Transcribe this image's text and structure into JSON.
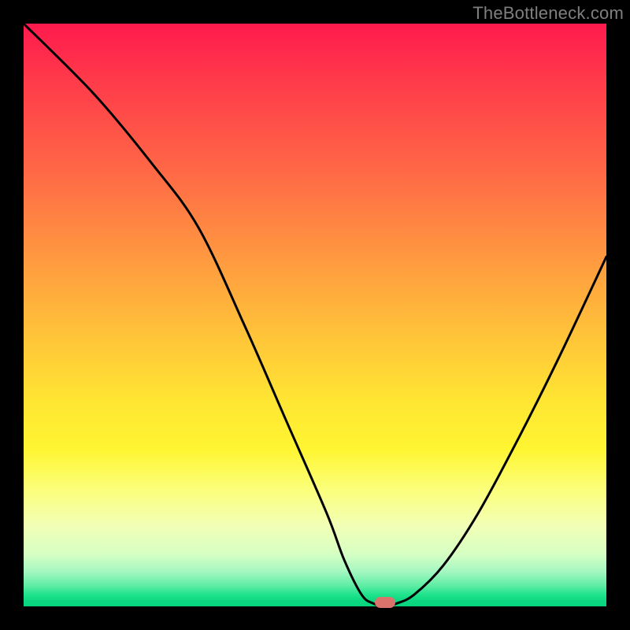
{
  "watermark": "TheBottleneck.com",
  "marker": {
    "x_pct": 62,
    "y_pct": 99.3
  },
  "chart_data": {
    "type": "line",
    "title": "",
    "xlabel": "",
    "ylabel": "",
    "xlim": [
      0,
      100
    ],
    "ylim": [
      0,
      100
    ],
    "grid": false,
    "series": [
      {
        "name": "bottleneck-curve",
        "x": [
          0,
          12,
          22,
          30,
          38,
          45,
          52,
          55,
          58,
          60,
          62,
          64,
          67,
          72,
          78,
          85,
          92,
          100
        ],
        "values": [
          100,
          88,
          76,
          65,
          48,
          32,
          16,
          8,
          2,
          0.5,
          0,
          0.5,
          2,
          7,
          16,
          29,
          43,
          60
        ]
      }
    ],
    "annotations": [
      {
        "type": "marker",
        "x": 62,
        "y": 0.7,
        "shape": "pill",
        "color": "#d9736b"
      }
    ],
    "background_gradient": {
      "direction": "vertical",
      "stops": [
        {
          "pct": 0,
          "color": "#ff1a4d"
        },
        {
          "pct": 50,
          "color": "#ffb63c"
        },
        {
          "pct": 75,
          "color": "#fff531"
        },
        {
          "pct": 100,
          "color": "#07d57e"
        }
      ]
    }
  }
}
